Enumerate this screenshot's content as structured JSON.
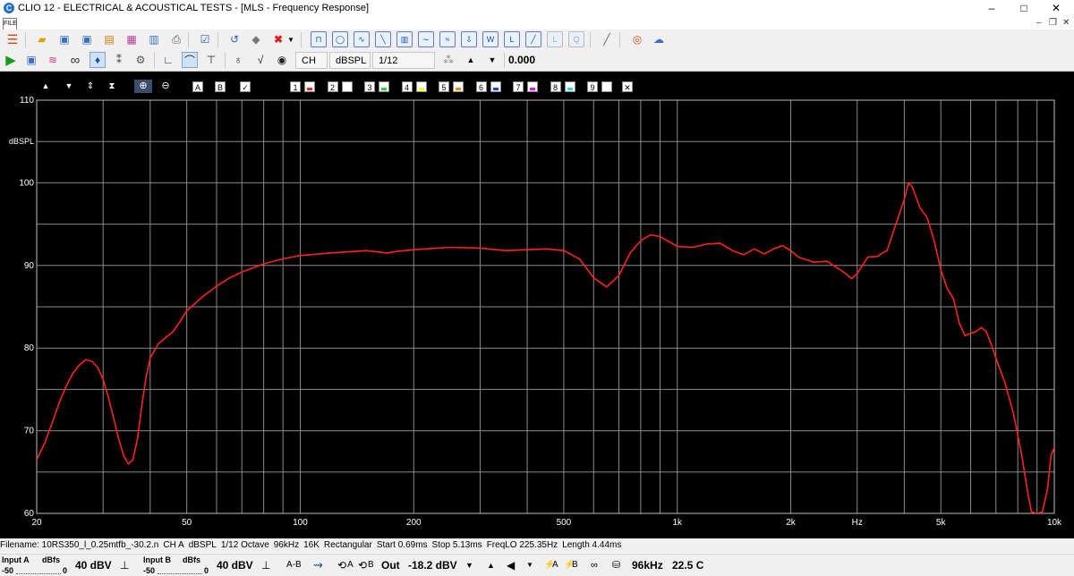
{
  "window": {
    "title": "CLIO 12 - ELECTRICAL & ACOUSTICAL TESTS - [MLS - Frequency Response]",
    "logo_letter": "C",
    "controls": {
      "minimize": "–",
      "maximize": "□",
      "close": "✕"
    },
    "sub_controls": {
      "minimize": "–",
      "restore": "❐",
      "close": "✕"
    }
  },
  "menu": {
    "icon_label": "FILE"
  },
  "toolbar2": {
    "channel": "CH A",
    "unit": "dBSPL",
    "smoothing": "1/12 Octave",
    "value": "0.000"
  },
  "plot_toolbar": {
    "label_A": "A",
    "label_B": "B",
    "overlays": [
      {
        "num": "1",
        "color": "#ff2020"
      },
      {
        "num": "2",
        "color": "#ffffff"
      },
      {
        "num": "3",
        "color": "#22dd22"
      },
      {
        "num": "4",
        "color": "#ffff00"
      },
      {
        "num": "5",
        "color": "#ff8c00"
      },
      {
        "num": "6",
        "color": "#1040ff"
      },
      {
        "num": "7",
        "color": "#ff00ff"
      },
      {
        "num": "8",
        "color": "#20e0e0"
      },
      {
        "num": "9",
        "color": "#ffffff"
      }
    ],
    "close_label": "✕"
  },
  "chart_data": {
    "type": "line",
    "ylabel": "dBSPL",
    "xlabel": "Hz",
    "x_scale": "log",
    "xlim": [
      20,
      10000
    ],
    "ylim": [
      60,
      110
    ],
    "x_ticks": [
      {
        "value": 20,
        "label": "20"
      },
      {
        "value": 50,
        "label": "50"
      },
      {
        "value": 100,
        "label": "100"
      },
      {
        "value": 200,
        "label": "200"
      },
      {
        "value": 500,
        "label": "500"
      },
      {
        "value": 1000,
        "label": "1k"
      },
      {
        "value": 2000,
        "label": "2k"
      },
      {
        "value": 5000,
        "label": "5k"
      },
      {
        "value": 10000,
        "label": "10k"
      }
    ],
    "y_ticks": [
      {
        "value": 110,
        "label": "110"
      },
      {
        "value": 100,
        "label": "100"
      },
      {
        "value": 90,
        "label": "90"
      },
      {
        "value": 80,
        "label": "80"
      },
      {
        "value": 70,
        "label": "70"
      },
      {
        "value": 60,
        "label": "60"
      }
    ],
    "grid": true,
    "series": [
      {
        "color": "#ff2020",
        "points": [
          [
            20,
            66.5
          ],
          [
            21,
            68.5
          ],
          [
            22,
            71
          ],
          [
            23,
            73.5
          ],
          [
            24,
            75.5
          ],
          [
            25,
            77
          ],
          [
            26,
            78
          ],
          [
            27,
            78.6
          ],
          [
            28,
            78.4
          ],
          [
            29,
            77.7
          ],
          [
            30,
            76.2
          ],
          [
            31,
            74
          ],
          [
            32,
            71.5
          ],
          [
            33,
            69
          ],
          [
            34,
            67
          ],
          [
            35,
            66
          ],
          [
            36,
            66.5
          ],
          [
            37,
            69
          ],
          [
            38,
            73
          ],
          [
            39,
            76.5
          ],
          [
            40,
            78.8
          ],
          [
            42,
            80.5
          ],
          [
            44,
            81.3
          ],
          [
            46,
            82
          ],
          [
            48,
            83.2
          ],
          [
            50,
            84.5
          ],
          [
            55,
            86.2
          ],
          [
            60,
            87.5
          ],
          [
            65,
            88.5
          ],
          [
            70,
            89.2
          ],
          [
            80,
            90.2
          ],
          [
            90,
            90.8
          ],
          [
            100,
            91.2
          ],
          [
            120,
            91.5
          ],
          [
            150,
            91.8
          ],
          [
            170,
            91.5
          ],
          [
            180,
            91.7
          ],
          [
            200,
            91.9
          ],
          [
            250,
            92.2
          ],
          [
            300,
            92.1
          ],
          [
            350,
            91.8
          ],
          [
            400,
            91.9
          ],
          [
            450,
            92.0
          ],
          [
            500,
            91.8
          ],
          [
            550,
            90.8
          ],
          [
            600,
            88.5
          ],
          [
            650,
            87.4
          ],
          [
            700,
            88.8
          ],
          [
            750,
            91.5
          ],
          [
            800,
            93.0
          ],
          [
            850,
            93.7
          ],
          [
            900,
            93.5
          ],
          [
            950,
            92.9
          ],
          [
            1000,
            92.3
          ],
          [
            1100,
            92.2
          ],
          [
            1200,
            92.6
          ],
          [
            1300,
            92.7
          ],
          [
            1400,
            91.8
          ],
          [
            1500,
            91.3
          ],
          [
            1600,
            92.0
          ],
          [
            1700,
            91.4
          ],
          [
            1800,
            92.0
          ],
          [
            1900,
            92.4
          ],
          [
            2000,
            91.8
          ],
          [
            2100,
            91.0
          ],
          [
            2300,
            90.4
          ],
          [
            2500,
            90.5
          ],
          [
            2600,
            90.0
          ],
          [
            2800,
            89.0
          ],
          [
            2900,
            88.4
          ],
          [
            3000,
            89.0
          ],
          [
            3200,
            91.0
          ],
          [
            3400,
            91.1
          ],
          [
            3500,
            91.5
          ],
          [
            3600,
            91.8
          ],
          [
            3800,
            95.0
          ],
          [
            4000,
            98.0
          ],
          [
            4100,
            100.0
          ],
          [
            4200,
            99.5
          ],
          [
            4400,
            97.0
          ],
          [
            4600,
            95.8
          ],
          [
            4800,
            93.0
          ],
          [
            5000,
            89.5
          ],
          [
            5200,
            87.2
          ],
          [
            5400,
            86.0
          ],
          [
            5600,
            83.0
          ],
          [
            5800,
            81.5
          ],
          [
            6000,
            81.8
          ],
          [
            6200,
            82.0
          ],
          [
            6400,
            82.5
          ],
          [
            6600,
            82.0
          ],
          [
            6800,
            80.5
          ],
          [
            7000,
            78.8
          ],
          [
            7400,
            75.8
          ],
          [
            7800,
            72.0
          ],
          [
            8200,
            67.0
          ],
          [
            8500,
            62.5
          ],
          [
            8700,
            60.2
          ],
          [
            9000,
            60.0
          ],
          [
            9300,
            60.2
          ],
          [
            9600,
            63.0
          ],
          [
            9800,
            67.0
          ],
          [
            10000,
            68.0
          ],
          [
            10300,
            67.0
          ],
          [
            10600,
            67.3
          ],
          [
            11000,
            66.8
          ],
          [
            11300,
            67.0
          ],
          [
            11600,
            66.0
          ],
          [
            12000,
            64.0
          ]
        ]
      }
    ]
  },
  "info": {
    "filename": "Filename: 10RS350_l_0.25mtfb_-30.2.n",
    "channel": "CH A",
    "unit": "dBSPL",
    "smoothing": "1/12 Octave",
    "rate": "96kHz",
    "size": "16K",
    "window": "Rectangular",
    "start": "Start 0.69ms",
    "stop": "Stop 5.13ms",
    "freqlo": "FreqLO 225.35Hz",
    "length": "Length 4.44ms"
  },
  "status": {
    "input_a_label": "Input A",
    "input_b_label": "Input B",
    "dbfs_label": "dBfs",
    "scale_min": "-50",
    "scale_max": "0",
    "input_a_range": "40 dBV",
    "input_b_range": "40 dBV",
    "a_minus_b": "A-B",
    "out_label": "Out",
    "out_level": "-18.2 dBV",
    "sample_rate": "96kHz",
    "temperature": "22.5 C",
    "out_a": "A",
    "out_b": "B"
  }
}
